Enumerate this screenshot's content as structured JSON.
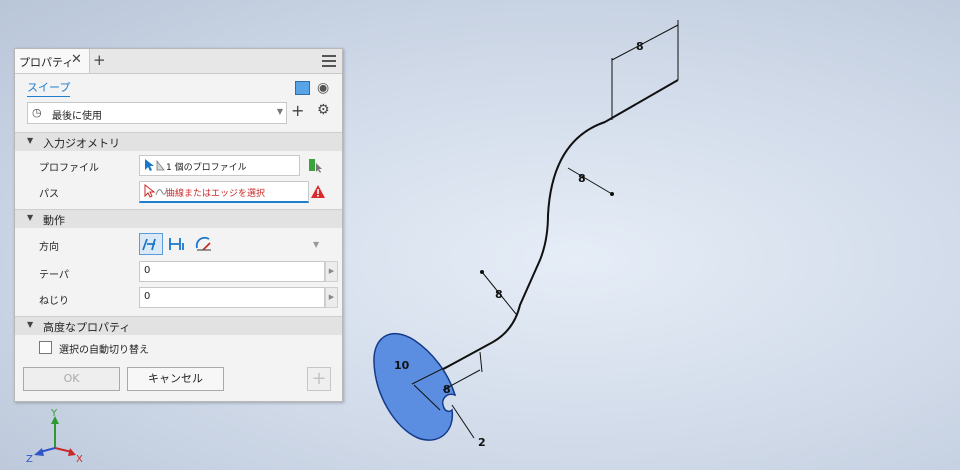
{
  "panel": {
    "tab_label": "プロパティ",
    "command_title": "スイープ",
    "preset_value": "最後に使用",
    "sections": {
      "input_geometry": "入力ジオメトリ",
      "behavior": "動作",
      "advanced": "高度なプロパティ"
    },
    "profile": {
      "label": "プロファイル",
      "value": "1 個のプロファイル"
    },
    "path": {
      "label": "パス",
      "value": "曲線またはエッジを選択"
    },
    "direction": {
      "label": "方向"
    },
    "taper": {
      "label": "テーパ",
      "value": "0"
    },
    "twist": {
      "label": "ねじり",
      "value": "0"
    },
    "auto_switch_label": "選択の自動切り替え",
    "ok_label": "OK",
    "cancel_label": "キャンセル"
  },
  "viewport": {
    "dimensions": [
      "8",
      "8",
      "8",
      "10",
      "8",
      "2"
    ],
    "triad": {
      "y": "Y",
      "x": "X",
      "z": "Z"
    }
  },
  "colors": {
    "profile_fill": "#5b8ee0",
    "link_blue": "#1e7fd0",
    "error_red": "#cc2a2a"
  }
}
